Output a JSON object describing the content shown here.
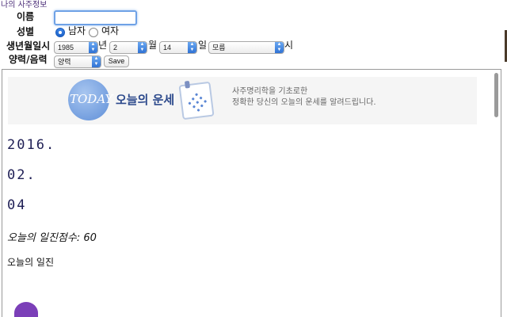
{
  "form": {
    "section_title": "나의 사주정보",
    "name_label": "이름",
    "name_value": "",
    "gender_label": "성별",
    "gender_male": "남자",
    "gender_female": "여자",
    "gender_selected": "male",
    "birth_label": "생년월일시",
    "year_value": "1985",
    "year_unit": "년",
    "month_value": "2",
    "month_unit": "월",
    "day_value": "14",
    "day_unit": "일",
    "hour_value": "모름",
    "hour_unit": "시",
    "calendar_label": "양력/음력",
    "calendar_value": "양력",
    "save_label": "Save"
  },
  "banner": {
    "today": "TODAY",
    "title": "오늘의 운세",
    "desc_line1": "사주명리학을 기초로한",
    "desc_line2": "정확한 당신의 오늘의 운세를 알려드립니다."
  },
  "result": {
    "date_year": "2016.",
    "date_month": "02.",
    "date_day": "04",
    "score_text": "오늘의 일진점수: 60",
    "ilgin_heading": "오늘의 일진"
  },
  "colors": {
    "accent_blue": "#2f72d4",
    "section_title": "#4b2d78",
    "date_text": "#1f1f55"
  }
}
